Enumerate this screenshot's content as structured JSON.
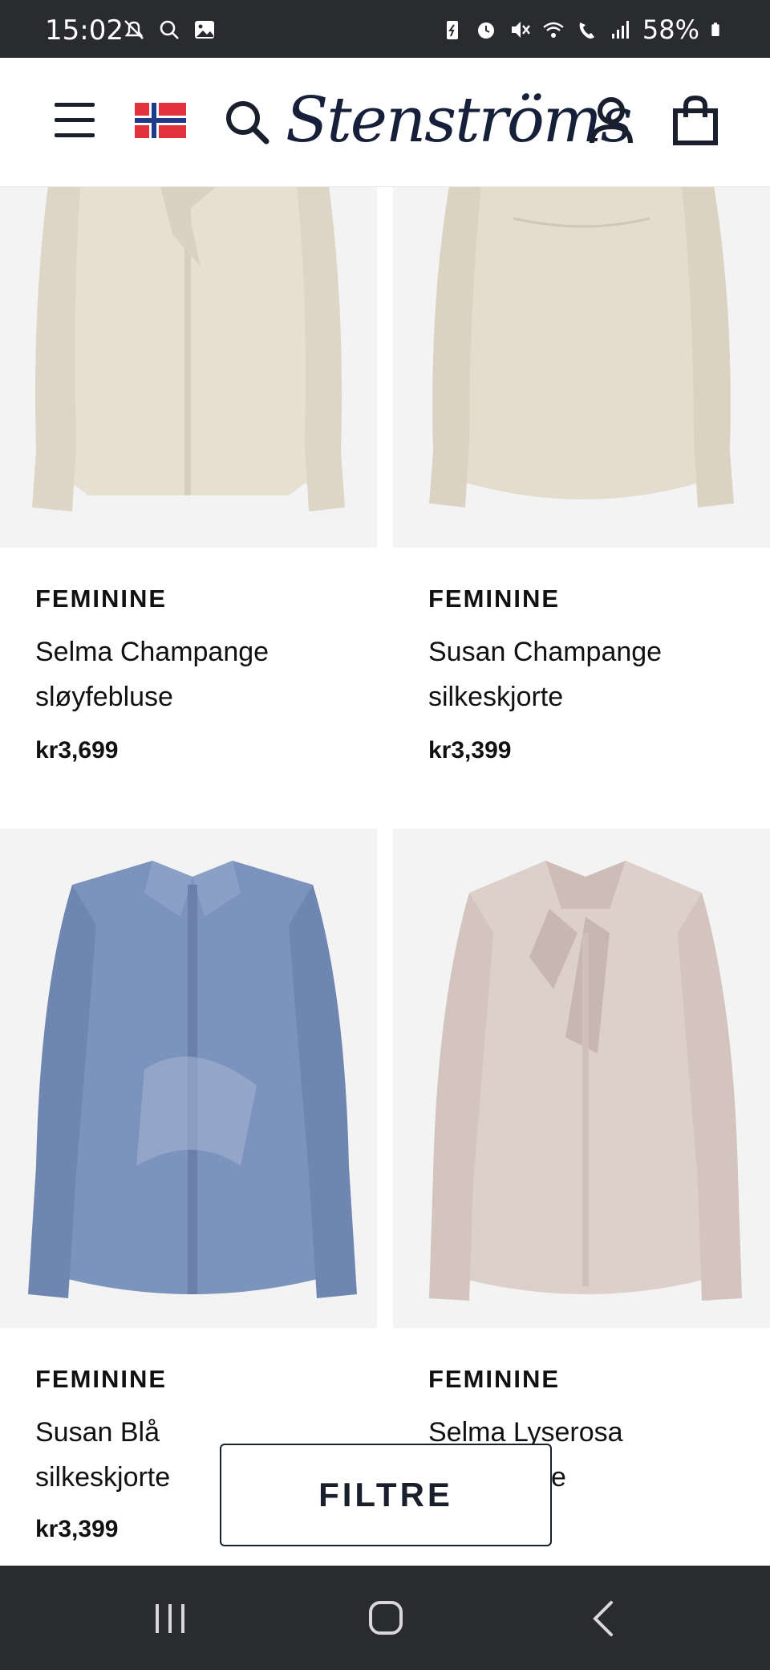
{
  "status_bar": {
    "time": "15:02",
    "battery": "58%",
    "left_icons": [
      "notifications-off-icon",
      "search-icon",
      "gallery-icon"
    ],
    "right_icons": [
      "battery-saver-icon",
      "alarm-icon",
      "mute-icon",
      "wifi-icon",
      "wifi-call-icon",
      "signal-icon",
      "battery-icon"
    ]
  },
  "header": {
    "logo_text": "Stenströms",
    "icons": [
      "menu-icon",
      "norway-flag-icon",
      "search-icon",
      "account-icon",
      "shopping-bag-icon"
    ]
  },
  "products": [
    {
      "brand": "FEMININE",
      "name_line1": "Selma Champange",
      "name_line2": "sløyfebluse",
      "price": "kr3,699"
    },
    {
      "brand": "FEMININE",
      "name_line1": "Susan Champange",
      "name_line2": "silkeskjorte",
      "price": "kr3,399"
    },
    {
      "brand": "FEMININE",
      "name_line1": "Susan Blå",
      "name_line2": "silkeskjorte",
      "price": "kr3,399"
    },
    {
      "brand": "FEMININE",
      "name_line1": "Selma Lyserosa",
      "name_line2": "sløyfebluse",
      "price": ""
    }
  ],
  "filter_button": {
    "label": "FILTRE"
  },
  "colors": {
    "status_bar_bg": "#2a2b2f",
    "brand_navy": "#17203a",
    "image_bg": "#f3f3f3",
    "champagne": "#e6dfd2",
    "blue_shirt": "#7c93bd",
    "pink_shirt": "#ddcfca"
  }
}
